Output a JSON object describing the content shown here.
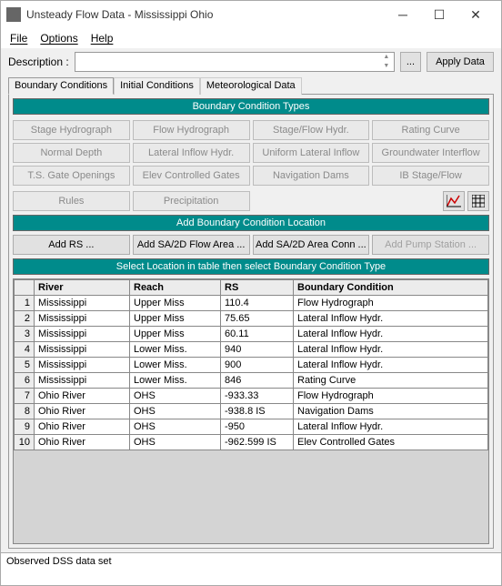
{
  "window": {
    "title": "Unsteady Flow Data - Mississippi Ohio"
  },
  "menu": {
    "file": "File",
    "options": "Options",
    "help": "Help"
  },
  "desc": {
    "label": "Description :",
    "apply": "Apply Data",
    "browse": "..."
  },
  "tabs": {
    "bc": "Boundary Conditions",
    "ic": "Initial Conditions",
    "met": "Meteorological Data"
  },
  "sections": {
    "types": "Boundary Condition Types",
    "add": "Add Boundary Condition Location",
    "select": "Select Location in table then select Boundary Condition Type"
  },
  "bcTypes": {
    "r1": [
      "Stage Hydrograph",
      "Flow Hydrograph",
      "Stage/Flow Hydr.",
      "Rating Curve"
    ],
    "r2": [
      "Normal Depth",
      "Lateral Inflow Hydr.",
      "Uniform Lateral Inflow",
      "Groundwater Interflow"
    ],
    "r3": [
      "T.S. Gate Openings",
      "Elev Controlled Gates",
      "Navigation Dams",
      "IB Stage/Flow"
    ],
    "r4": [
      "Rules",
      "Precipitation"
    ]
  },
  "addBtns": {
    "rs": "Add RS ...",
    "sa2d": "Add SA/2D Flow Area ...",
    "conn": "Add SA/2D Area Conn ...",
    "pump": "Add Pump Station ..."
  },
  "cols": {
    "river": "River",
    "reach": "Reach",
    "rs": "RS",
    "bc": "Boundary Condition"
  },
  "rows": [
    {
      "n": "1",
      "river": "Mississippi",
      "reach": "Upper Miss",
      "rs": "110.4",
      "bc": "Flow Hydrograph"
    },
    {
      "n": "2",
      "river": "Mississippi",
      "reach": "Upper Miss",
      "rs": "75.65",
      "bc": "Lateral Inflow Hydr."
    },
    {
      "n": "3",
      "river": "Mississippi",
      "reach": "Upper Miss",
      "rs": "60.11",
      "bc": "Lateral Inflow Hydr."
    },
    {
      "n": "4",
      "river": "Mississippi",
      "reach": "Lower Miss.",
      "rs": "940",
      "bc": "Lateral Inflow Hydr."
    },
    {
      "n": "5",
      "river": "Mississippi",
      "reach": "Lower Miss.",
      "rs": "900",
      "bc": "Lateral Inflow Hydr."
    },
    {
      "n": "6",
      "river": "Mississippi",
      "reach": "Lower Miss.",
      "rs": "846",
      "bc": "Rating Curve"
    },
    {
      "n": "7",
      "river": "Ohio River",
      "reach": "OHS",
      "rs": "-933.33",
      "bc": "Flow Hydrograph"
    },
    {
      "n": "8",
      "river": "Ohio River",
      "reach": "OHS",
      "rs": "-938.8  IS",
      "bc": "Navigation Dams"
    },
    {
      "n": "9",
      "river": "Ohio River",
      "reach": "OHS",
      "rs": "-950",
      "bc": "Lateral Inflow Hydr."
    },
    {
      "n": "10",
      "river": "Ohio River",
      "reach": "OHS",
      "rs": "-962.599 IS",
      "bc": "Elev Controlled Gates"
    }
  ],
  "status": "Observed DSS data set"
}
